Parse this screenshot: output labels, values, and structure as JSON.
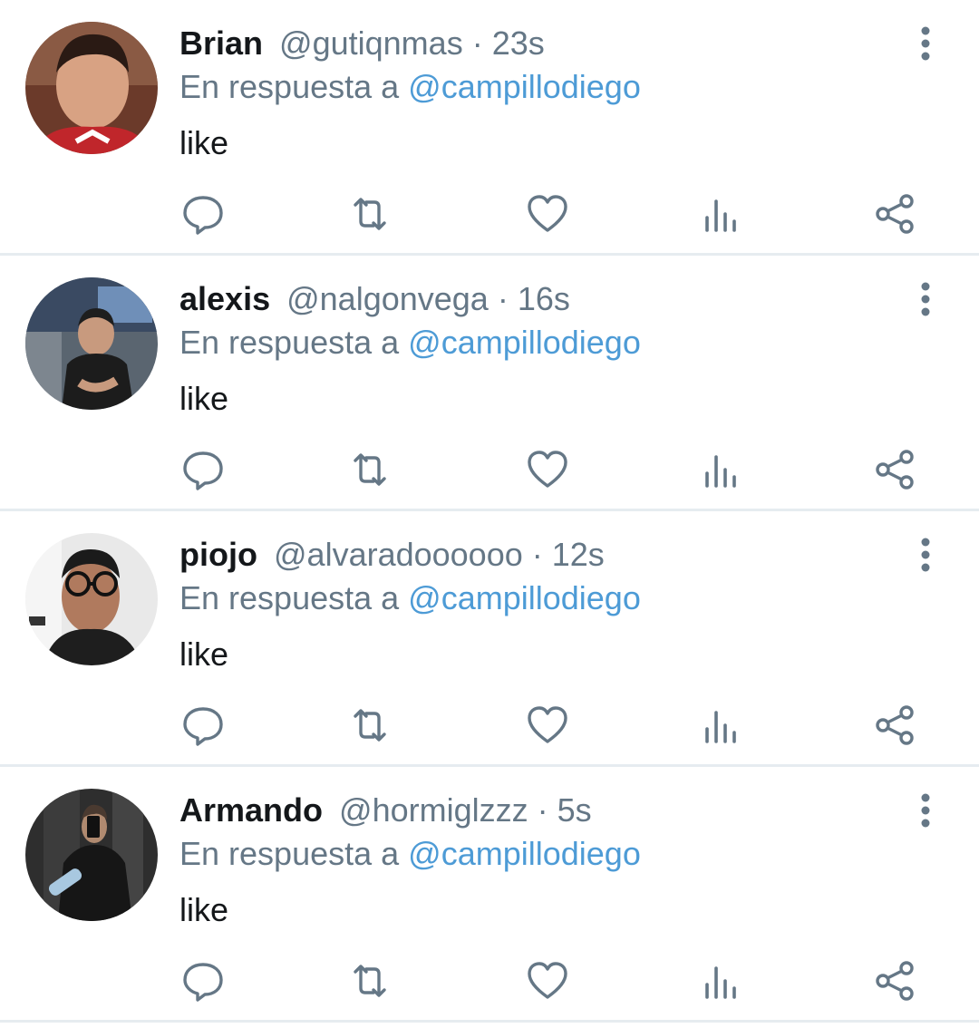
{
  "reply_prefix": "En respuesta a",
  "icons": {
    "reply": "comment-bubble-icon",
    "retweet": "retweet-icon",
    "like": "heart-icon",
    "stats": "bar-chart-icon",
    "share": "share-icon",
    "more": "vertical-dots-icon"
  },
  "colors": {
    "name": "#14171a",
    "secondary": "#657786",
    "mention": "#4d9bd6",
    "divider": "#e6ecf0"
  },
  "tweets": [
    {
      "name": "Brian",
      "handle": "@gutiqnmas",
      "time": "· 23s",
      "reply_to": "@campillodiego",
      "text": "like"
    },
    {
      "name": "alexis",
      "handle": "@nalgonvega",
      "time": "· 16s",
      "reply_to": "@campillodiego",
      "text": "like"
    },
    {
      "name": "piojo",
      "handle": "@alvaradoooooo",
      "time": "· 12s",
      "reply_to": "@campillodiego",
      "text": "like"
    },
    {
      "name": "Armando",
      "handle": "@hormiglzzz",
      "time": "· 5s",
      "reply_to": "@campillodiego",
      "text": "like"
    }
  ]
}
